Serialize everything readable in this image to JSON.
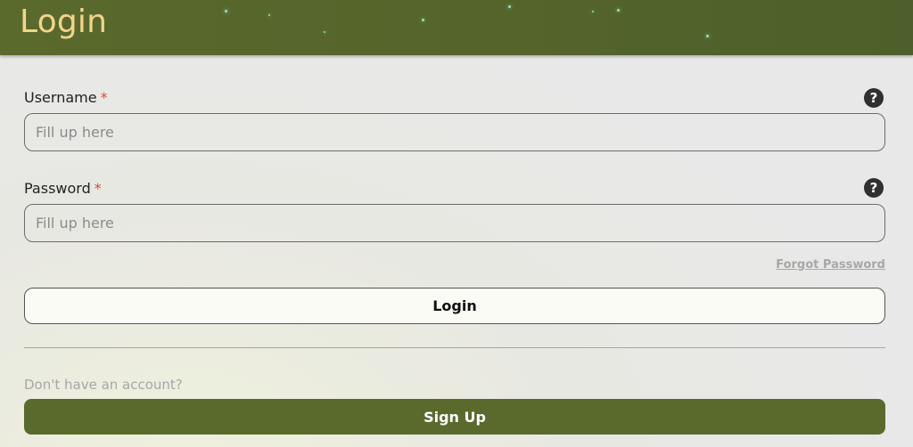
{
  "header": {
    "title": "Login"
  },
  "form": {
    "username": {
      "label": "Username",
      "required_marker": "*",
      "placeholder": "Fill up here",
      "value": "",
      "help_icon": "question-circle-icon"
    },
    "password": {
      "label": "Password",
      "required_marker": "*",
      "placeholder": "Fill up here",
      "value": "",
      "help_icon": "question-circle-icon"
    },
    "forgot_password_label": "Forgot Password",
    "login_label": "Login",
    "no_account_text": "Don't have an account?",
    "signup_label": "Sign Up"
  },
  "colors": {
    "header_bg": "#56662c",
    "title_text": "#f1d58b",
    "required": "#d24b3a",
    "signup_bg": "#5a6a2d",
    "muted_text": "#a7a7a7"
  }
}
